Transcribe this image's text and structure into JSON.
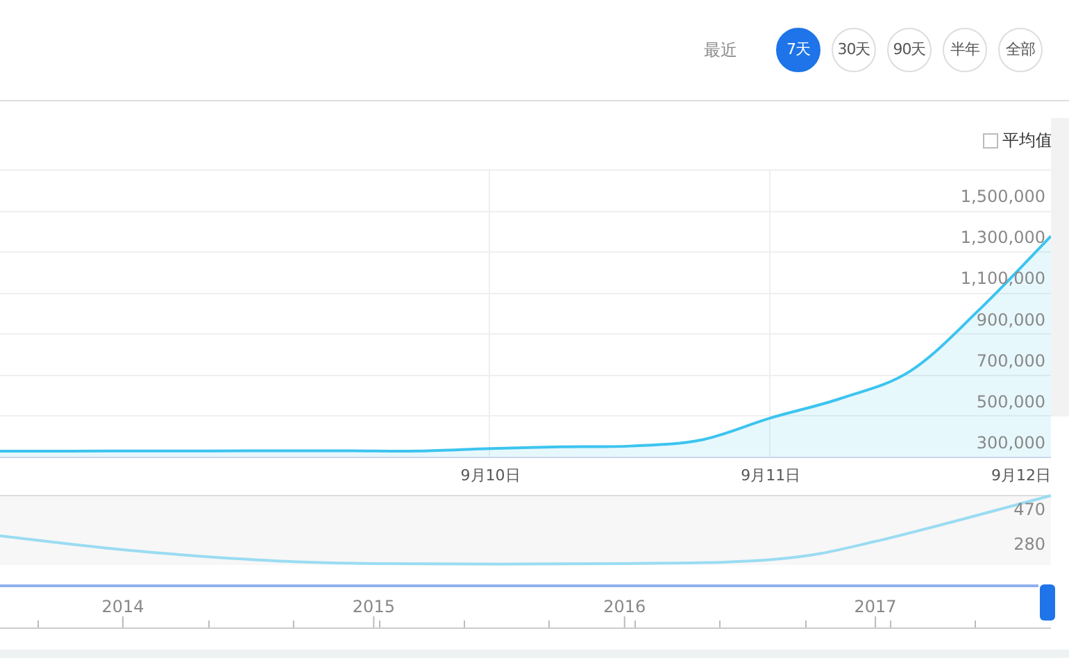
{
  "range_selector": {
    "label": "最近",
    "buttons": [
      {
        "label": "7天",
        "selected": true
      },
      {
        "label": "30天",
        "selected": false
      },
      {
        "label": "90天",
        "selected": false
      },
      {
        "label": "半年",
        "selected": false
      },
      {
        "label": "全部",
        "selected": false
      }
    ]
  },
  "average_toggle": {
    "label": "平均值",
    "checked": false
  },
  "chart": {
    "chart_data": {
      "type": "area",
      "categories": [
        null,
        null,
        null,
        null,
        null,
        null,
        null,
        "9月10日",
        null,
        null,
        null,
        "9月11日",
        null,
        null,
        null,
        "9月12日"
      ],
      "series": [
        {
          "color": "#3cc4ef",
          "values": [
            327000,
            327000,
            328000,
            328000,
            329000,
            329000,
            328000,
            340000,
            348000,
            352000,
            381000,
            489000,
            584000,
            719000,
            1024000,
            1375000
          ]
        }
      ],
      "ylim": [
        300000,
        1700000
      ],
      "grid": true,
      "yticks": [
        {
          "value": 300000,
          "label": "300,000"
        },
        {
          "value": 500000,
          "label": "500,000"
        },
        {
          "value": 700000,
          "label": "700,000"
        },
        {
          "value": 900000,
          "label": "900,000"
        },
        {
          "value": 1100000,
          "label": "1,100,000"
        },
        {
          "value": 1300000,
          "label": "1,300,000"
        },
        {
          "value": 1500000,
          "label": "1,500,000"
        }
      ]
    }
  },
  "navigator": {
    "chart_data": {
      "type": "line",
      "x": [
        2013.51,
        2014,
        2014.5,
        2015,
        2016,
        2016.6,
        2017,
        2017.7
      ],
      "series": [
        {
          "color": "#9adcf2",
          "values": [
            326,
            250,
            197,
            174,
            174,
            197,
            295,
            546
          ]
        }
      ],
      "xlim": [
        2013.51,
        2017.7
      ],
      "ylim": [
        166,
        546
      ],
      "xticks": [
        {
          "value": 2014,
          "label": "2014"
        },
        {
          "value": 2015,
          "label": "2015"
        },
        {
          "value": 2016,
          "label": "2016"
        },
        {
          "value": 2017,
          "label": "2017"
        }
      ],
      "yticks": [
        {
          "value": 280,
          "label": "280"
        },
        {
          "value": 470,
          "label": "470"
        }
      ]
    }
  }
}
